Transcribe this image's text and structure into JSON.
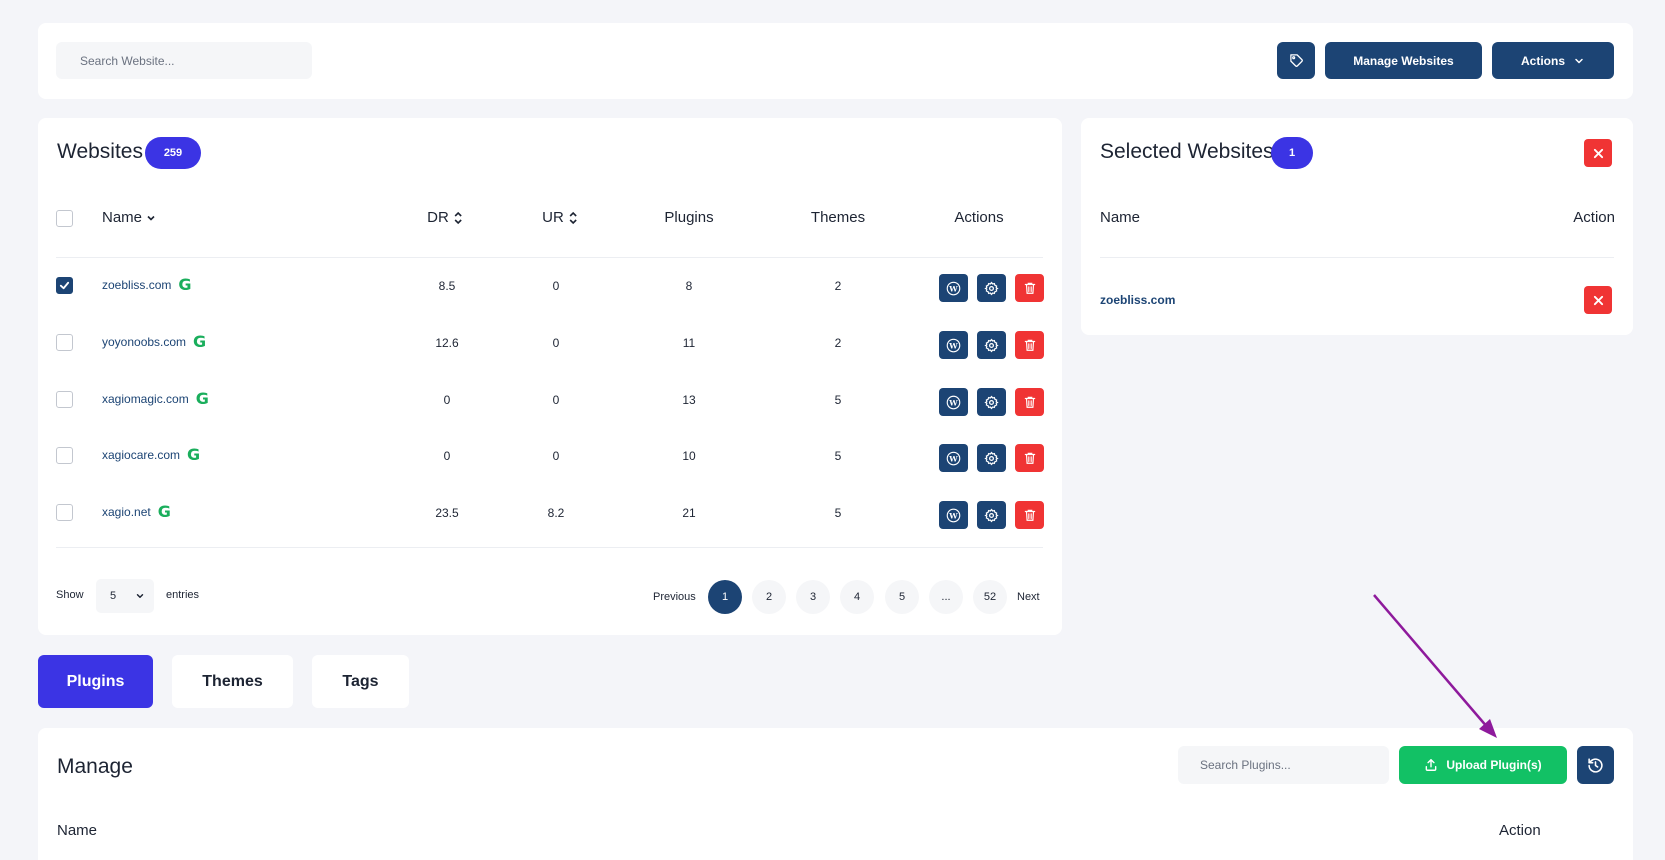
{
  "topbar": {
    "search_placeholder": "Search Website...",
    "tag_icon": "tag-icon",
    "manage_label": "Manage Websites",
    "actions_label": "Actions"
  },
  "websites": {
    "title": "Websites",
    "count": "259",
    "columns": {
      "name": "Name",
      "dr": "DR",
      "ur": "UR",
      "plugins": "Plugins",
      "themes": "Themes",
      "actions": "Actions"
    },
    "rows": [
      {
        "name": "zoebliss.com",
        "dr": "8.5",
        "ur": "0",
        "plugins": "8",
        "themes": "2",
        "checked": true
      },
      {
        "name": "yoyonoobs.com",
        "dr": "12.6",
        "ur": "0",
        "plugins": "11",
        "themes": "2",
        "checked": false
      },
      {
        "name": "xagiomagic.com",
        "dr": "0",
        "ur": "0",
        "plugins": "13",
        "themes": "5",
        "checked": false
      },
      {
        "name": "xagiocare.com",
        "dr": "0",
        "ur": "0",
        "plugins": "10",
        "themes": "5",
        "checked": false
      },
      {
        "name": "xagio.net",
        "dr": "23.5",
        "ur": "8.2",
        "plugins": "21",
        "themes": "5",
        "checked": false
      }
    ],
    "show_label": "Show",
    "entries_value": "5",
    "entries_label": "entries",
    "pagination": {
      "previous": "Previous",
      "pages": [
        "1",
        "2",
        "3",
        "4",
        "5",
        "...",
        "52"
      ],
      "active": "1",
      "next": "Next"
    }
  },
  "selected": {
    "title": "Selected Websites",
    "count": "1",
    "col_name": "Name",
    "col_action": "Action",
    "rows": [
      {
        "name": "zoebliss.com"
      }
    ]
  },
  "tabs": [
    {
      "label": "Plugins",
      "active": true
    },
    {
      "label": "Themes",
      "active": false
    },
    {
      "label": "Tags",
      "active": false
    }
  ],
  "manage": {
    "title": "Manage",
    "search_placeholder": "Search Plugins...",
    "upload_label": "Upload Plugin(s)",
    "col_name": "Name",
    "col_action": "Action"
  },
  "colors": {
    "navy": "#1c4474",
    "indigo": "#3b34e4",
    "red": "#f03434",
    "green": "#12c165",
    "annotation_arrow": "#8e1a9c"
  }
}
